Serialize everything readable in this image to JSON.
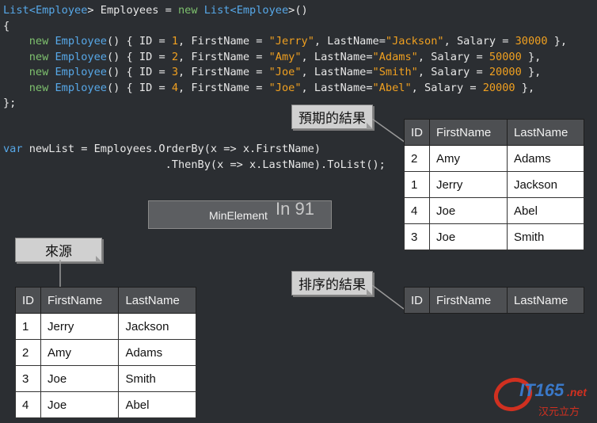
{
  "code": {
    "line1": {
      "t1": "List",
      "t2": "<",
      "t3": "Employee",
      "t4": "> Employees = ",
      "t5": "new ",
      "t6": "List",
      "t7": "<",
      "t8": "Employee",
      "t9": ">()"
    },
    "brace_open": "{",
    "brace_close": "};",
    "rows": [
      {
        "id": "1",
        "first": "\"Jerry\"",
        "last": "\"Jackson\"",
        "salary": "30000",
        "tail": " },"
      },
      {
        "id": "2",
        "first": "\"Amy\"",
        "last": "\"Adams\"",
        "salary": "50000",
        "tail": " },"
      },
      {
        "id": "3",
        "first": "\"Joe\"",
        "last": "\"Smith\"",
        "salary": "20000",
        "tail": " },"
      },
      {
        "id": "4",
        "first": "\"Joe\"",
        "last": "\"Abel\"",
        "salary": "20000",
        "tail": " },"
      }
    ],
    "row_new": "new ",
    "row_type": "Employee",
    "row_p1": "() { ID = ",
    "row_p2": ", FirstName = ",
    "row_p3": ", LastName=",
    "row_p4": ", Salary = ",
    "var_kw": "var",
    "var_rest": " newList = Employees.OrderBy(x => x.FirstName)",
    "then_line": "                         .ThenBy(x => x.LastName).ToList();"
  },
  "callouts": {
    "expected": "預期的結果",
    "source": "來源",
    "sorted": "排序的結果"
  },
  "headers": {
    "id": "ID",
    "first": "FirstName",
    "last": "LastName"
  },
  "expected_table": [
    [
      "2",
      "Amy",
      "Adams"
    ],
    [
      "1",
      "Jerry",
      "Jackson"
    ],
    [
      "4",
      "Joe",
      "Abel"
    ],
    [
      "3",
      "Joe",
      "Smith"
    ]
  ],
  "source_table": [
    [
      "1",
      "Jerry",
      "Jackson"
    ],
    [
      "2",
      "Amy",
      "Adams"
    ],
    [
      "3",
      "Joe",
      "Smith"
    ],
    [
      "4",
      "Joe",
      "Abel"
    ]
  ],
  "minbar": {
    "label": "MinElement",
    "number": "In 91"
  },
  "logo": {
    "main": "IT165",
    "suffix": ".net",
    "sub": "汉元立方"
  },
  "colors": {
    "background": "#2b2e32",
    "keyword": "#7ec16e",
    "type": "#57a8e8",
    "literal": "#f0a020",
    "header": "#4d4f52"
  }
}
